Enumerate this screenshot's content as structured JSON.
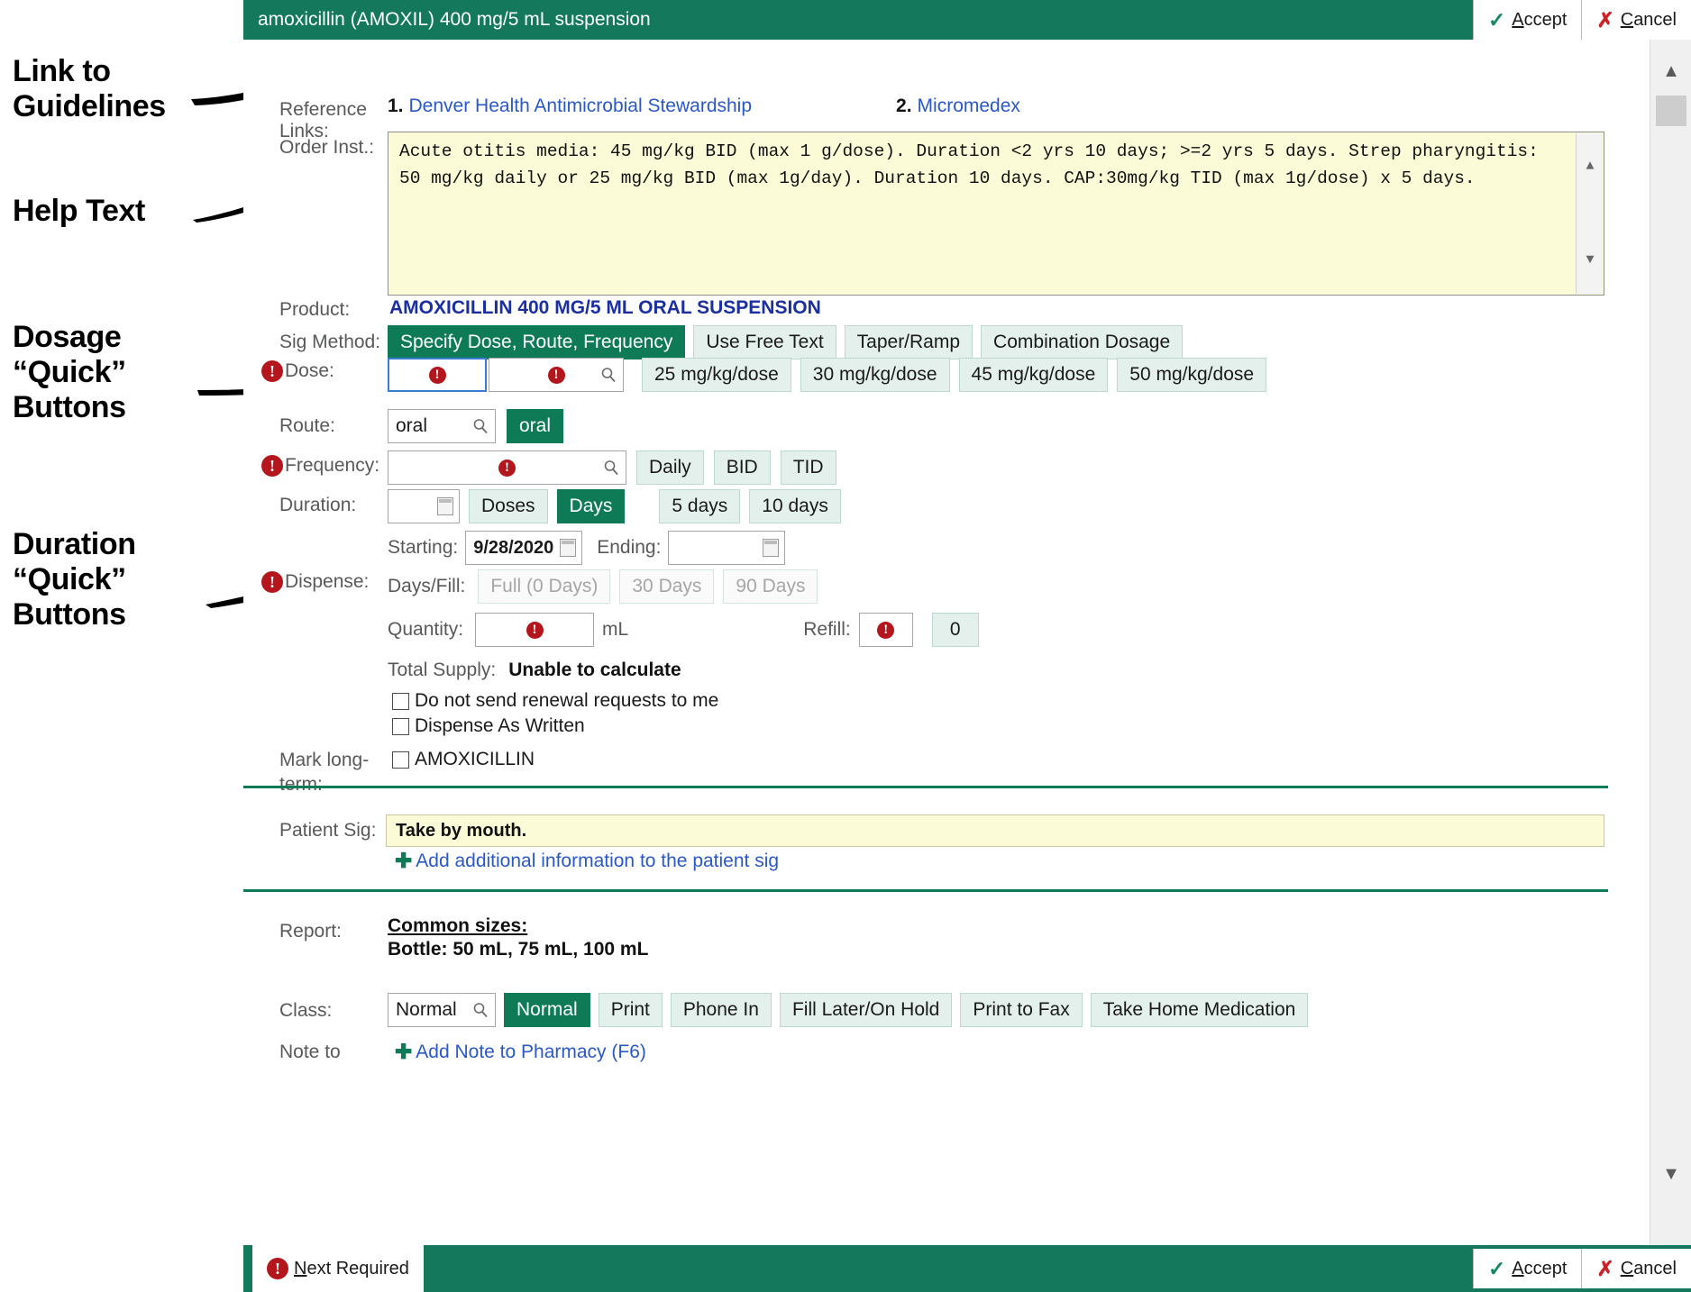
{
  "annotations": [
    {
      "id": "a1",
      "text": "Link to\nGuidelines"
    },
    {
      "id": "a2",
      "text": "Help Text"
    },
    {
      "id": "a3",
      "text": "Dosage\n“Quick”\nButtons"
    },
    {
      "id": "a4",
      "text": "Duration\n“Quick”\nButtons"
    }
  ],
  "titlebar": {
    "title": "amoxicillin (AMOXIL) 400 mg/5 mL suspension",
    "accept_label": "Accept",
    "cancel_label": "Cancel",
    "accept_icon": "check-icon",
    "cancel_icon": "x-icon"
  },
  "reference_links": {
    "label": "Reference Links:",
    "items": [
      {
        "num": "1.",
        "text": "Denver Health Antimicrobial Stewardship"
      },
      {
        "num": "2.",
        "text": "Micromedex"
      }
    ]
  },
  "order_inst": {
    "label": "Order Inst.:",
    "text": "Acute otitis media: 45 mg/kg BID (max 1 g/dose). Duration <2 yrs 10 days; >=2 yrs 5 days. Strep pharyngitis: 50 mg/kg daily or 25 mg/kg BID (max 1g/day). Duration 10 days. CAP:30mg/kg TID (max 1g/dose) x 5 days."
  },
  "product": {
    "label": "Product:",
    "value": "AMOXICILLIN 400 MG/5 ML ORAL SUSPENSION"
  },
  "sig_method": {
    "label": "Sig Method:",
    "options": [
      {
        "label": "Specify Dose, Route, Frequency",
        "selected": true
      },
      {
        "label": "Use Free Text",
        "selected": false
      },
      {
        "label": "Taper/Ramp",
        "selected": false
      },
      {
        "label": "Combination Dosage",
        "selected": false
      }
    ]
  },
  "dose": {
    "label": "Dose:",
    "required": true,
    "amount_value": "",
    "unit_value": "",
    "quick_buttons": [
      "25 mg/kg/dose",
      "30 mg/kg/dose",
      "45 mg/kg/dose",
      "50 mg/kg/dose"
    ]
  },
  "route": {
    "label": "Route:",
    "value": "oral",
    "quick_buttons": [
      {
        "label": "oral",
        "selected": true
      }
    ]
  },
  "frequency": {
    "label": "Frequency:",
    "required": true,
    "value": "",
    "quick_buttons": [
      "Daily",
      "BID",
      "TID"
    ]
  },
  "duration": {
    "label": "Duration:",
    "value": "",
    "unit_buttons": [
      {
        "label": "Doses",
        "selected": false
      },
      {
        "label": "Days",
        "selected": true
      }
    ],
    "quick_buttons": [
      "5 days",
      "10 days"
    ]
  },
  "dates": {
    "starting_label": "Starting:",
    "starting_value": "9/28/2020",
    "ending_label": "Ending:",
    "ending_value": ""
  },
  "dispense": {
    "label": "Dispense:",
    "required": true,
    "days_fill_label": "Days/Fill:",
    "days_fill_buttons": [
      "Full (0 Days)",
      "30 Days",
      "90 Days"
    ]
  },
  "quantity": {
    "label": "Quantity:",
    "value": "",
    "unit": "mL",
    "refill_label": "Refill:",
    "refill_value": "",
    "refill_quick": "0"
  },
  "total_supply": {
    "label": "Total Supply:",
    "value": "Unable to calculate"
  },
  "checkboxes": [
    {
      "label": "Do not send renewal requests to me",
      "checked": false
    },
    {
      "label": "Dispense As Written",
      "checked": false
    }
  ],
  "mark_long_term": {
    "label": "Mark long-term:",
    "label_line1": "Mark long-",
    "label_line2": "term:",
    "checkbox_label": "AMOXICILLIN",
    "checked": false
  },
  "patient_sig": {
    "label": "Patient Sig:",
    "value": "Take by mouth.",
    "add_link": "Add additional information to the patient sig",
    "add_icon": "plus-icon"
  },
  "report": {
    "label": "Report:",
    "heading": "Common sizes:",
    "line": "Bottle: 50 mL, 75 mL, 100 mL"
  },
  "class": {
    "label": "Class:",
    "value": "Normal",
    "quick_buttons": [
      {
        "label": "Normal",
        "selected": true
      },
      {
        "label": "Print",
        "selected": false
      },
      {
        "label": "Phone In",
        "selected": false
      },
      {
        "label": "Fill Later/On Hold",
        "selected": false
      },
      {
        "label": "Print to Fax",
        "selected": false
      },
      {
        "label": "Take Home Medication",
        "selected": false
      }
    ]
  },
  "note_to": {
    "label": "Note to",
    "add_link": "Add Note to Pharmacy (F6)",
    "add_icon": "plus-icon"
  },
  "footer": {
    "next_required": "Next Required",
    "accept_label": "Accept",
    "cancel_label": "Cancel"
  },
  "colors": {
    "brand_green": "#14795c",
    "selected_green": "#0f7b56",
    "quick_btn_bg": "#e4f0ec",
    "required_red": "#b3161c",
    "link_blue": "#2b58c8",
    "product_blue": "#1c2fa0",
    "help_yellow": "#fcfbd7"
  }
}
